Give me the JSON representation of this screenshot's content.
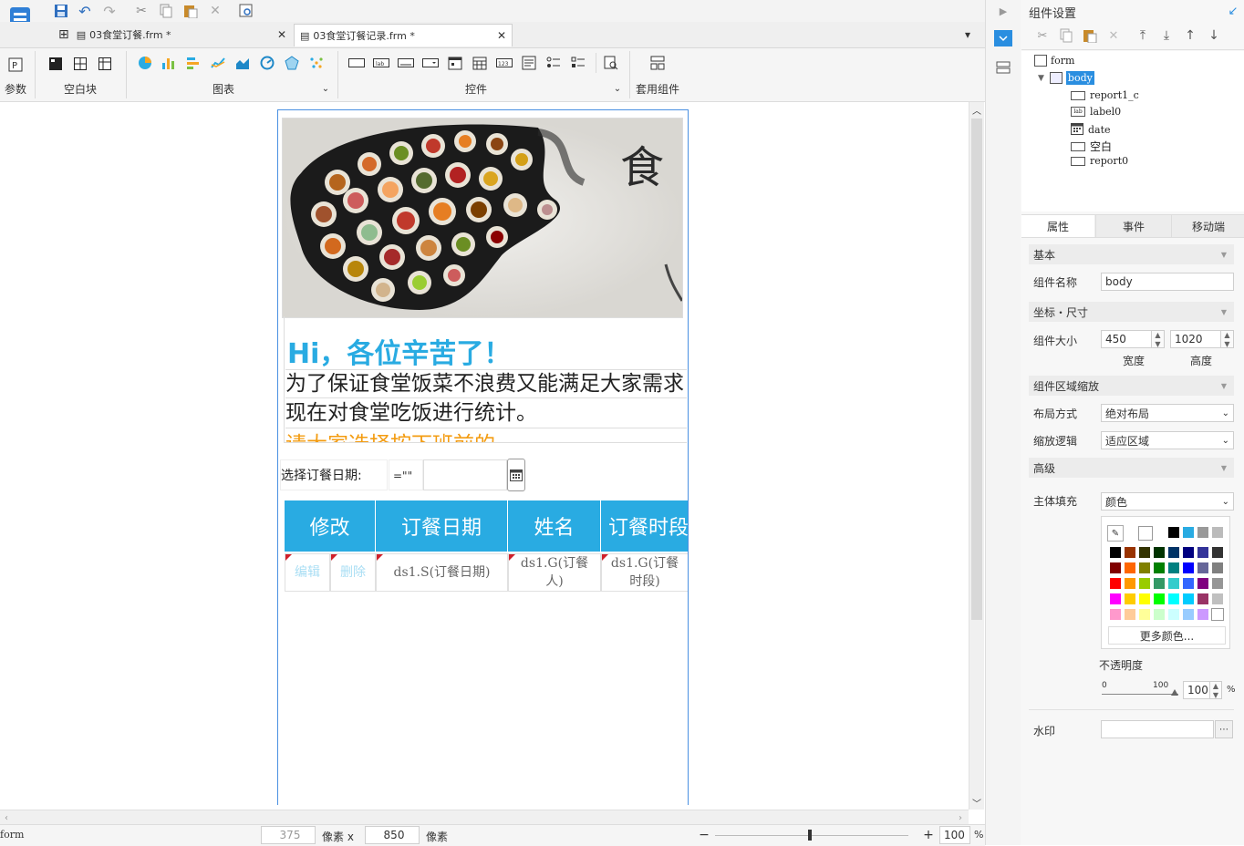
{
  "tabs": [
    {
      "label": "03食堂订餐.frm *"
    },
    {
      "label": "03食堂订餐记录.frm *"
    }
  ],
  "ribbon": {
    "groups": [
      "参数",
      "空白块",
      "图表",
      "控件",
      "套用组件"
    ]
  },
  "form": {
    "greeting": "Hi，各位辛苦了！",
    "line1": "为了保证食堂饭菜不浪费又能满足大家需求",
    "line2": "现在对食堂吃饭进行统计。",
    "line3": "请大家选择按下班前的",
    "date_label": "选择订餐日期:",
    "date_op": "=\"\"",
    "table": {
      "headers": [
        "修改",
        "订餐日期",
        "姓名",
        "订餐时段"
      ],
      "row": [
        "编辑",
        "删除",
        "ds1.S(订餐日期)",
        "ds1.G(订餐人)",
        "ds1.G(订餐时段)"
      ]
    }
  },
  "status": {
    "left": "form",
    "x": "375",
    "x_unit": "像素 x",
    "y": "850",
    "y_unit": "像素",
    "zoom": "100",
    "zoom_unit": "%"
  },
  "panel": {
    "title": "组件设置",
    "tree": [
      "form",
      "body",
      "report1_c",
      "label0",
      "date",
      "空白",
      "report0"
    ],
    "tabs": [
      "属性",
      "事件",
      "移动端"
    ],
    "sections": {
      "basic": "基本",
      "coords": "坐标・尺寸",
      "scale": "组件区域缩放",
      "advanced": "高级"
    },
    "name_label": "组件名称",
    "name_value": "body",
    "size_label": "组件大小",
    "width": "450",
    "height": "1020",
    "width_label": "宽度",
    "height_label": "高度",
    "layout_label": "布局方式",
    "layout_value": "绝对布局",
    "scale_label": "缩放逻辑",
    "scale_value": "适应区域",
    "fill_label": "主体填充",
    "fill_value": "颜色",
    "more_colors": "更多颜色...",
    "opacity_label": "不透明度",
    "opacity_min": "0",
    "opacity_max": "100",
    "opacity_value": "100",
    "opacity_unit": "%",
    "watermark_label": "水印"
  },
  "colors": {
    "accent": "#29abe2",
    "greeting": "#29abe2",
    "form_border": "#4a90e2",
    "orange_text": "#f39c12"
  }
}
